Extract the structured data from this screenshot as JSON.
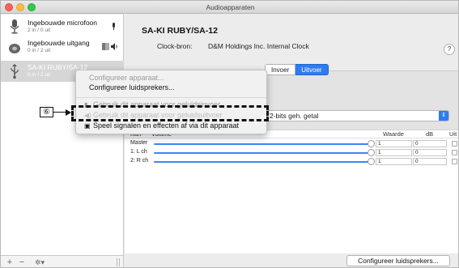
{
  "window": {
    "title": "Audioapparaten"
  },
  "sidebar": {
    "devices": [
      {
        "name": "Ingebouwde microfoon",
        "io": "2 in / 0 uit",
        "icon": "microphone-icon"
      },
      {
        "name": "Ingebouwde uitgang",
        "io": "0 in / 2 uit",
        "icon": "speaker-icon"
      },
      {
        "name": "SA-KI RUBY/SA-12",
        "io": "0 in / 2 uit",
        "icon": "usb-icon"
      }
    ],
    "bottom": {
      "add": "+",
      "remove": "−",
      "gear": "✲▾"
    }
  },
  "main": {
    "device_title": "SA-KI RUBY/SA-12",
    "clock_label": "Clock-bron:",
    "clock_value": "D&M Holdings Inc. Internal Clock",
    "help": "?",
    "tabs": [
      {
        "label": "Invoer"
      },
      {
        "label": "Uitvoer",
        "selected": true
      }
    ],
    "format_value": "2-bits geh. getal",
    "table": {
      "headers": {
        "kan": "Kan",
        "volume": "Volume",
        "waarde": "Waarde",
        "db": "dB",
        "uit": "Uit"
      },
      "rows": [
        {
          "label": "Master",
          "value": "1",
          "db": "0",
          "volume_level": 1.0
        },
        {
          "label": "1: L ch",
          "value": "1",
          "db": "0",
          "volume_level": 1.0
        },
        {
          "label": "2: R ch",
          "value": "1",
          "db": "0",
          "volume_level": 1.0
        }
      ]
    },
    "config_button": "Configureer luidsprekers..."
  },
  "context_menu": {
    "items": [
      {
        "label": "Configureer apparaat...",
        "state": "disabled"
      },
      {
        "label": "Configureer luidsprekers...",
        "state": "enabled"
      },
      {
        "label": "Gebruik dit apparaat voor geluidsinvoer",
        "state": "disabled",
        "icon": "microphone-icon"
      },
      {
        "label": "Gebruik dit apparaat voor geluidsuitvoer",
        "state": "focused",
        "icon": "speaker-icon"
      },
      {
        "label": "Speel signalen en effecten af via dit apparaat",
        "state": "enabled",
        "icon": "finder-icon"
      }
    ]
  },
  "annotation": {
    "label": "⑥"
  }
}
